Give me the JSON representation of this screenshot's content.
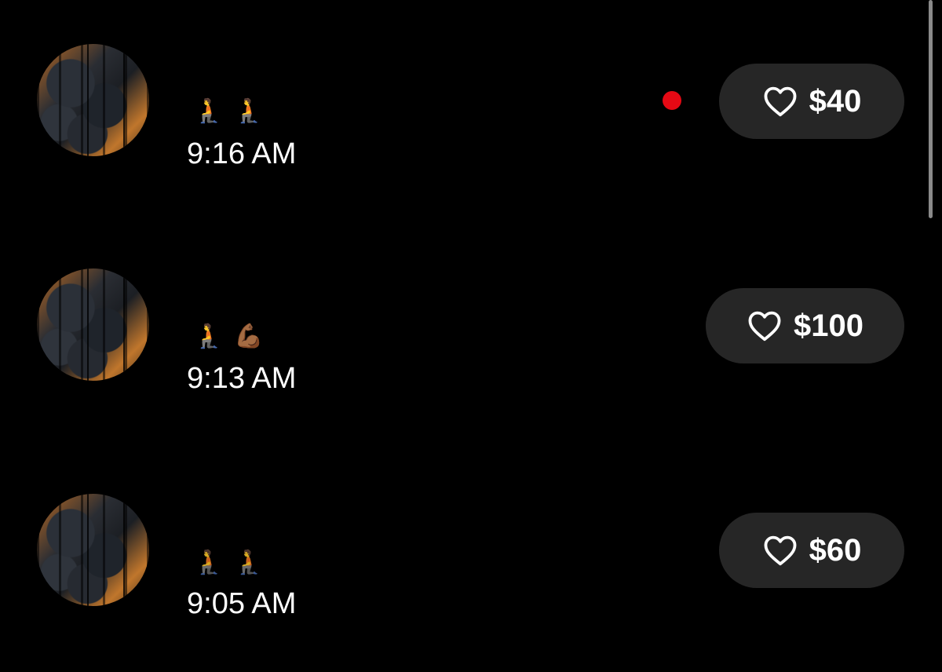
{
  "theme": {
    "background": "#000000",
    "pill_background": "#262626",
    "text": "#ffffff",
    "unread_dot": "#e50914"
  },
  "messages": [
    {
      "emojis": [
        "🧎",
        "🧎"
      ],
      "time": "9:16 AM",
      "unread": true,
      "tip": {
        "icon": "heart-outline-icon",
        "amount": "$40"
      }
    },
    {
      "emojis": [
        "🧎",
        "💪🏾"
      ],
      "time": "9:13 AM",
      "unread": false,
      "tip": {
        "icon": "heart-outline-icon",
        "amount": "$100"
      }
    },
    {
      "emojis": [
        "🧎",
        "🧎"
      ],
      "time": "9:05 AM",
      "unread": false,
      "tip": {
        "icon": "heart-outline-icon",
        "amount": "$60"
      }
    }
  ]
}
